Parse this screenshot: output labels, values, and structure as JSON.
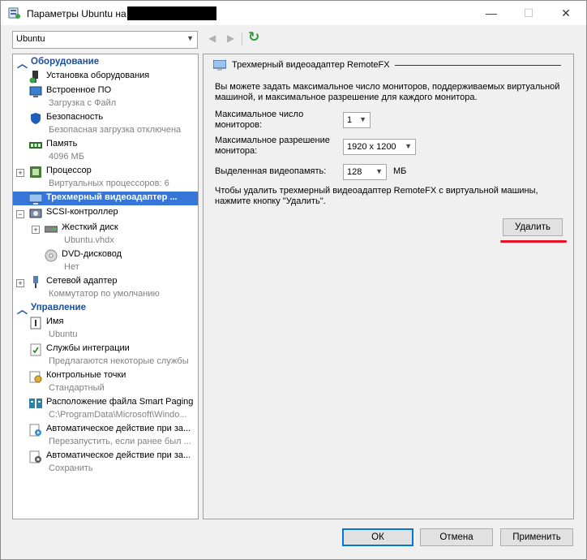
{
  "window": {
    "title": "Параметры Ubuntu на",
    "minimize": "—",
    "maximize": "☐",
    "close": "✕"
  },
  "vm_selector": {
    "value": "Ubuntu"
  },
  "nav": {
    "back": "◀",
    "forward": "▶",
    "refresh": "↻"
  },
  "tree": {
    "hardware_header": "Оборудование",
    "management_header": "Управление",
    "hardware_items": [
      {
        "label": "Установка оборудования",
        "sub": ""
      },
      {
        "label": "Встроенное ПО",
        "sub": "Загрузка с Файл"
      },
      {
        "label": "Безопасность",
        "sub": "Безопасная загрузка отключена"
      },
      {
        "label": "Память",
        "sub": "4096 МБ"
      },
      {
        "label": "Процессор",
        "sub": "Виртуальных процессоров: 6"
      },
      {
        "label": "Трехмерный видеоадаптер ...",
        "sub": ""
      },
      {
        "label": "SCSI-контроллер",
        "sub": ""
      },
      {
        "label": "Жесткий диск",
        "sub": "Ubuntu.vhdx"
      },
      {
        "label": "DVD-дисковод",
        "sub": "Нет"
      },
      {
        "label": "Сетевой адаптер",
        "sub": "Коммутатор по умолчанию"
      }
    ],
    "management_items": [
      {
        "label": "Имя",
        "sub": "Ubuntu"
      },
      {
        "label": "Службы интеграции",
        "sub": "Предлагаются некоторые службы"
      },
      {
        "label": "Контрольные точки",
        "sub": "Стандартный"
      },
      {
        "label": "Расположение файла Smart Paging",
        "sub": "C:\\ProgramData\\Microsoft\\Windo..."
      },
      {
        "label": "Автоматическое действие при за...",
        "sub": "Перезапустить, если ранее был ..."
      },
      {
        "label": "Автоматическое действие при за...",
        "sub": "Сохранить"
      }
    ]
  },
  "panel": {
    "title": "Трехмерный видеоадаптер RemoteFX",
    "description": "Вы можете задать максимальное число мониторов, поддерживаемых виртуальной машиной, и максимальное разрешение для каждого монитора.",
    "monitors_label": "Максимальное число мониторов:",
    "monitors_value": "1",
    "resolution_label": "Максимальное разрешение монитора:",
    "resolution_value": "1920 x 1200",
    "memory_label": "Выделенная видеопамять:",
    "memory_value": "128",
    "memory_unit": "МБ",
    "remove_hint": "Чтобы удалить трехмерный видеоадаптер RemoteFX с виртуальной машины, нажмите кнопку \"Удалить\".",
    "remove_button": "Удалить"
  },
  "footer": {
    "ok": "ОК",
    "cancel": "Отмена",
    "apply": "Применить"
  },
  "colors": {
    "selection": "#3676d8",
    "header_blue": "#1a4fa0",
    "annotation_red": "#e81123"
  }
}
